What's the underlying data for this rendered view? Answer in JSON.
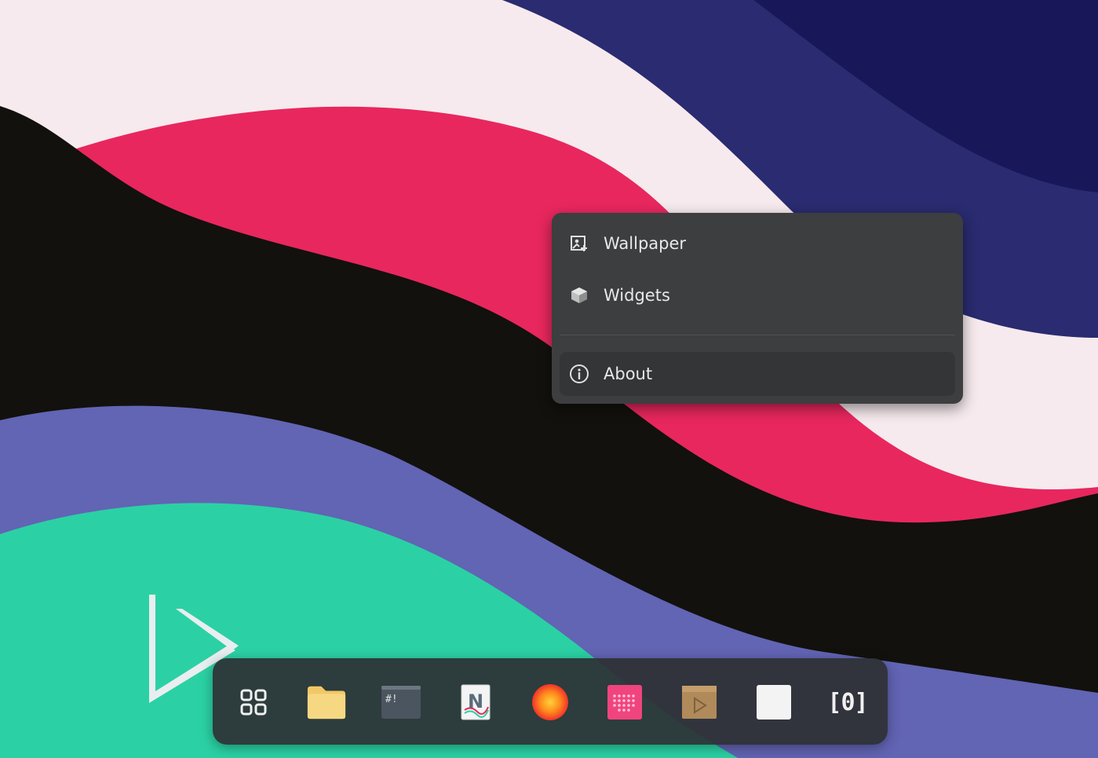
{
  "wallpaper": {
    "colors": {
      "background": "#f6eaee",
      "navy_dark": "#17175a",
      "navy": "#2a2b70",
      "pink": "#e8275e",
      "black": "#12110d",
      "periwinkle": "#6264b4",
      "teal": "#2bd1a4"
    },
    "logo_icon": "play-triangle-logo"
  },
  "context_menu": {
    "items": [
      {
        "label": "Wallpaper",
        "icon": "wallpaper-icon"
      },
      {
        "label": "Widgets",
        "icon": "widgets-cube-icon"
      },
      {
        "label": "About",
        "icon": "info-icon"
      }
    ],
    "highlighted_item": "About"
  },
  "dock": {
    "items": [
      {
        "name": "app-grid",
        "icon": "app-grid-icon"
      },
      {
        "name": "files",
        "icon": "folder-icon"
      },
      {
        "name": "terminal",
        "icon": "terminal-icon",
        "glyph": "#!"
      },
      {
        "name": "notes",
        "icon": "notes-icon",
        "glyph": "N"
      },
      {
        "name": "browser",
        "icon": "browser-orb-icon"
      },
      {
        "name": "music",
        "icon": "music-grid-icon"
      },
      {
        "name": "video",
        "icon": "video-player-icon"
      },
      {
        "name": "blank-app",
        "icon": "blank-app-icon"
      },
      {
        "name": "workspaces",
        "icon": "workspaces-icon",
        "glyph": "[0]"
      }
    ]
  }
}
